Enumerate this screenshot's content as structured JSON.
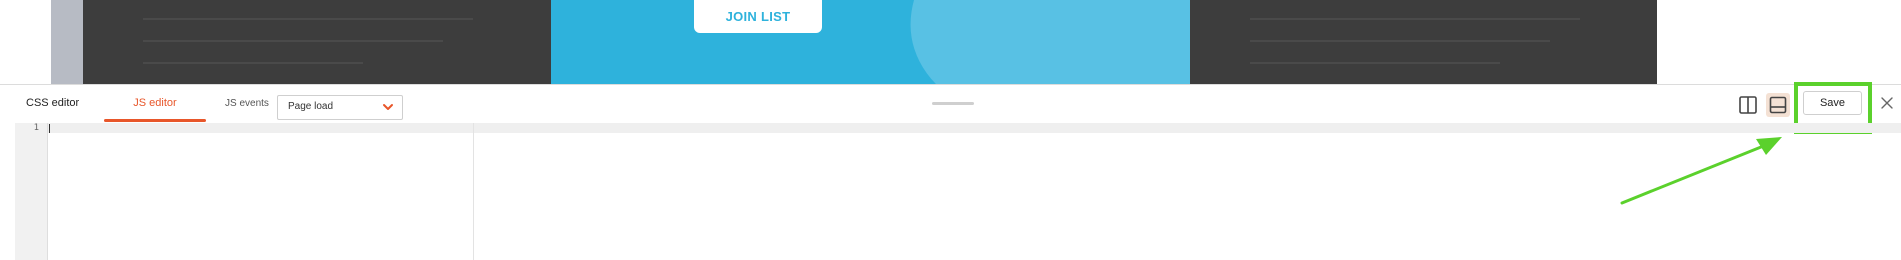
{
  "preview": {
    "join_button_label": "JOIN LIST",
    "colors": {
      "page_frame": "#b7bbc4",
      "dark_panel": "#3d3d3d",
      "accent_blue": "#2eb2dc",
      "light_blue": "#5fc3e5"
    }
  },
  "toolbar": {
    "tabs": [
      {
        "label": "CSS editor",
        "active": false
      },
      {
        "label": "JS editor",
        "active": true
      }
    ],
    "js_events": {
      "label": "JS events",
      "selected": "Page load"
    },
    "save_label": "Save",
    "colors": {
      "active_tab": "#e8562a",
      "highlight": "#5bd12c"
    }
  },
  "editor": {
    "line_numbers": [
      "1"
    ]
  },
  "icons": {
    "chevron": "chevron-down-icon",
    "layout_vertical": "split-vertical-icon",
    "layout_horizontal": "split-horizontal-icon",
    "close": "close-icon",
    "arrow": "annotation-arrow-icon"
  }
}
